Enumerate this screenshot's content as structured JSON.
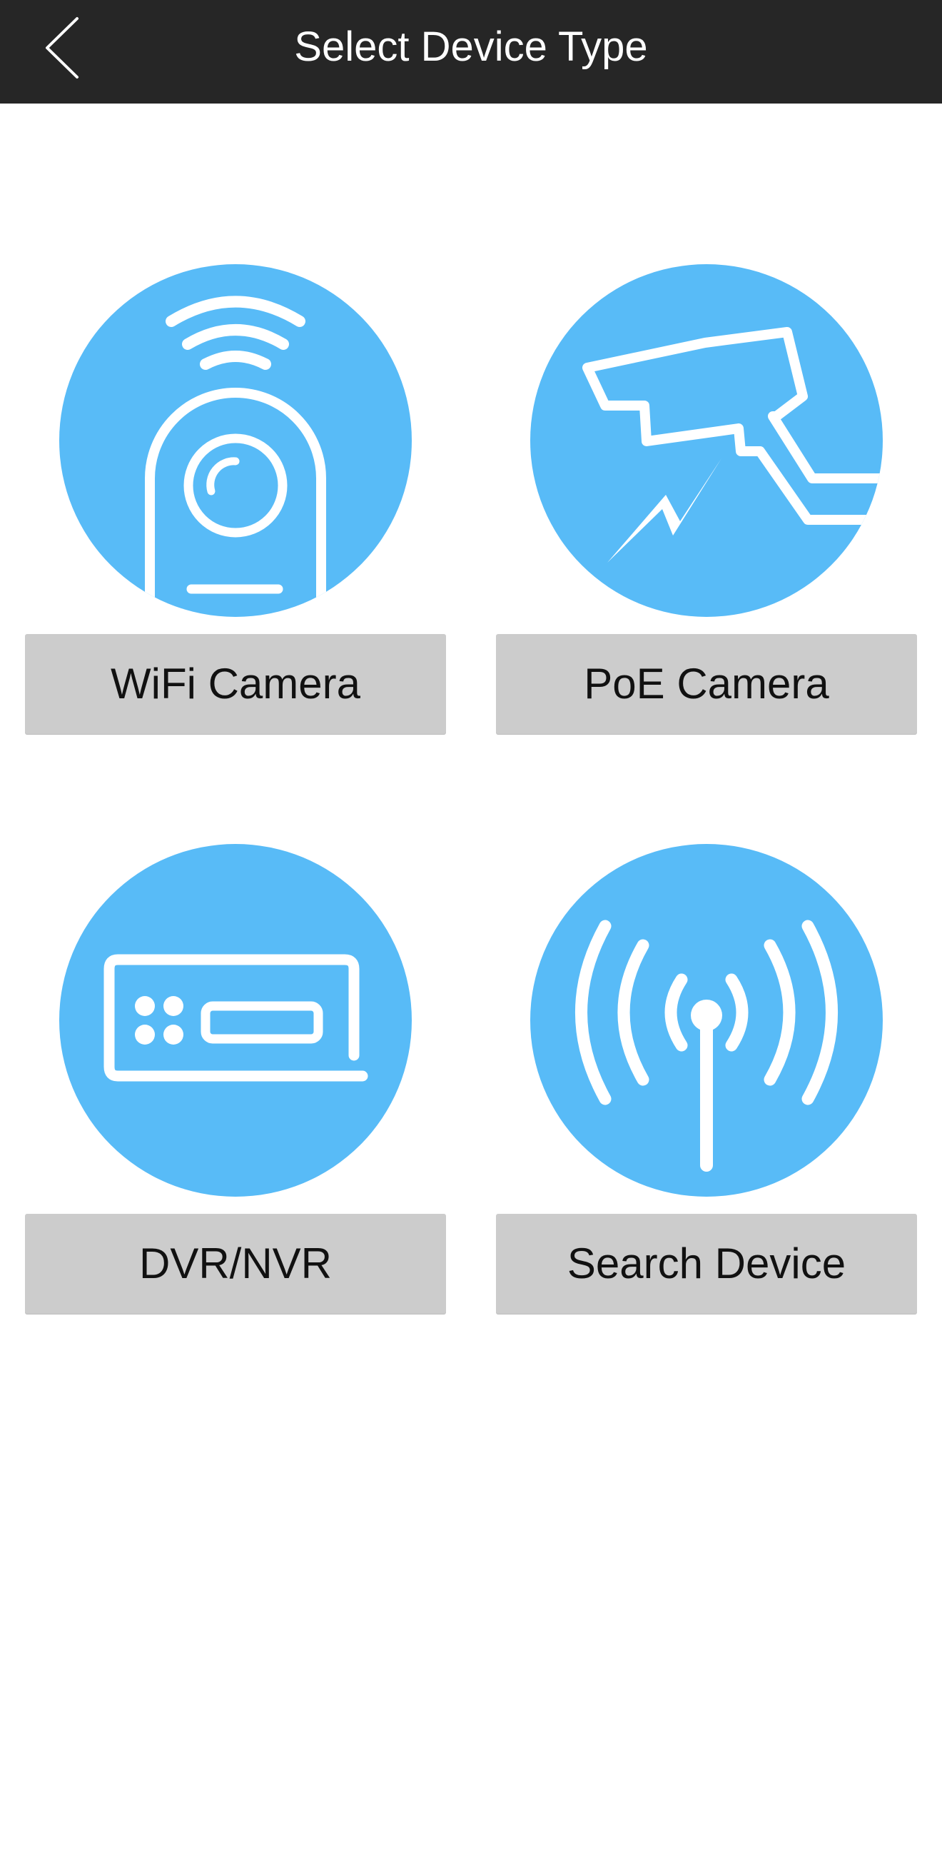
{
  "header": {
    "title": "Select Device Type",
    "back_icon": "chevron-left-icon"
  },
  "colors": {
    "header_bg": "#262626",
    "icon_circle": "#58bbf7",
    "button_bg": "#cccccc"
  },
  "tiles": [
    {
      "label": "WiFi Camera",
      "icon": "wifi-camera-icon"
    },
    {
      "label": "PoE Camera",
      "icon": "poe-camera-icon"
    },
    {
      "label": "DVR/NVR",
      "icon": "dvr-nvr-icon"
    },
    {
      "label": "Search Device",
      "icon": "search-device-icon"
    }
  ]
}
